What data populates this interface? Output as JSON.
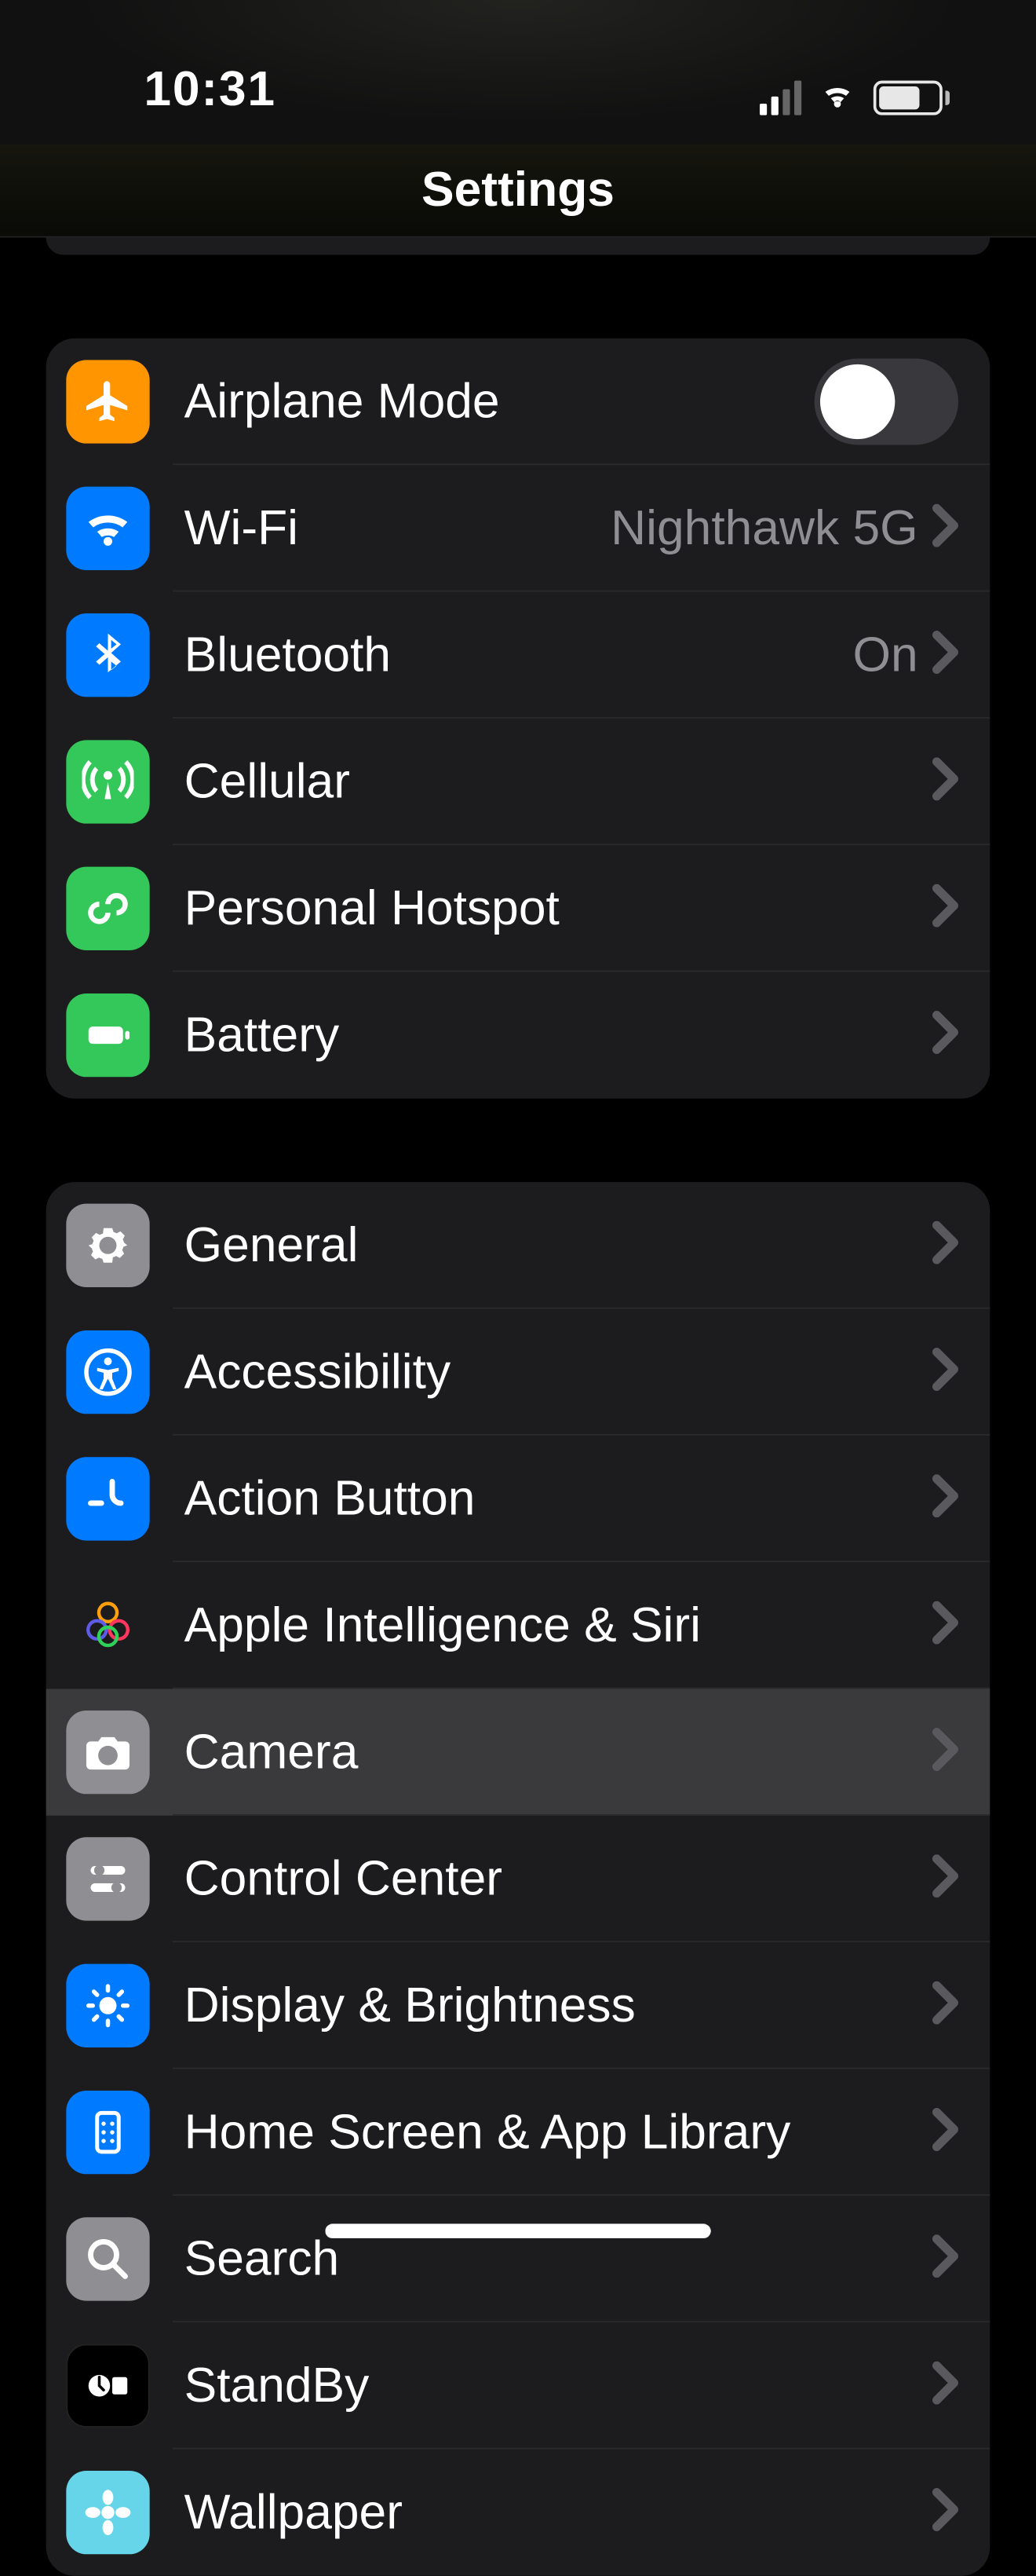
{
  "statusbar": {
    "time": "10:31"
  },
  "navbar": {
    "title": "Settings"
  },
  "groups": [
    {
      "id": "connectivity",
      "rows": [
        {
          "id": "airplane",
          "label": "Airplane Mode",
          "toggle": false
        },
        {
          "id": "wifi",
          "label": "Wi-Fi",
          "detail": "Nighthawk 5G",
          "disclosure": true
        },
        {
          "id": "bluetooth",
          "label": "Bluetooth",
          "detail": "On",
          "disclosure": true
        },
        {
          "id": "cellular",
          "label": "Cellular",
          "disclosure": true
        },
        {
          "id": "hotspot",
          "label": "Personal Hotspot",
          "disclosure": true
        },
        {
          "id": "battery",
          "label": "Battery",
          "disclosure": true
        }
      ]
    },
    {
      "id": "device",
      "rows": [
        {
          "id": "general",
          "label": "General",
          "disclosure": true
        },
        {
          "id": "accessibility",
          "label": "Accessibility",
          "disclosure": true
        },
        {
          "id": "actionbutton",
          "label": "Action Button",
          "disclosure": true
        },
        {
          "id": "siri",
          "label": "Apple Intelligence & Siri",
          "disclosure": true
        },
        {
          "id": "camera",
          "label": "Camera",
          "disclosure": true,
          "highlight": true
        },
        {
          "id": "controlcenter",
          "label": "Control Center",
          "disclosure": true
        },
        {
          "id": "display",
          "label": "Display & Brightness",
          "disclosure": true
        },
        {
          "id": "homescreen",
          "label": "Home Screen & App Library",
          "disclosure": true
        },
        {
          "id": "search",
          "label": "Search",
          "disclosure": true
        },
        {
          "id": "standby",
          "label": "StandBy",
          "disclosure": true
        },
        {
          "id": "wallpaper",
          "label": "Wallpaper",
          "disclosure": true
        }
      ]
    }
  ]
}
